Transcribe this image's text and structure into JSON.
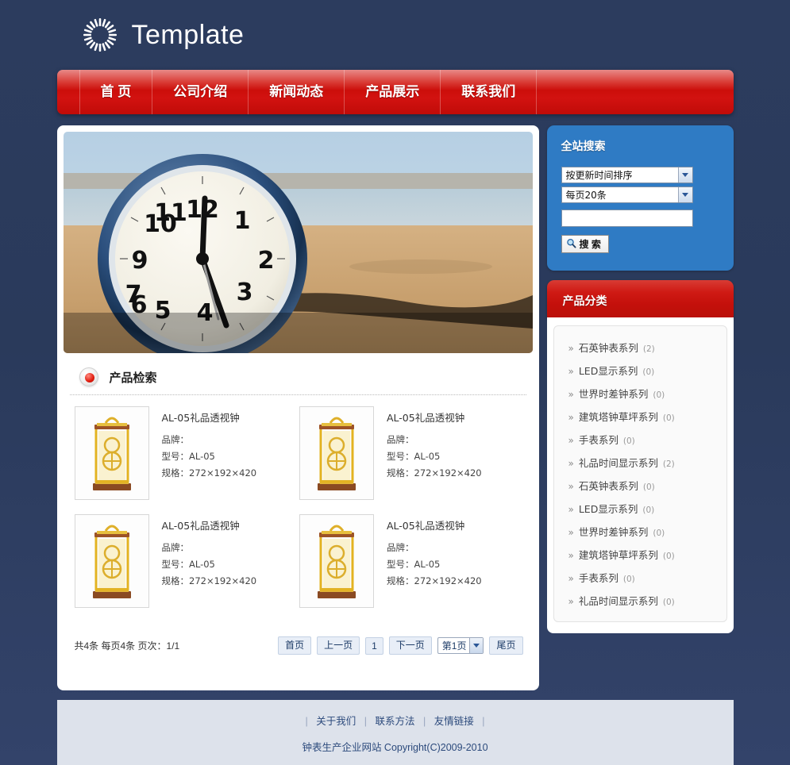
{
  "site": {
    "logo_icon": "sunburst-icon",
    "title": "Template"
  },
  "nav": {
    "items": [
      {
        "label": "首 页"
      },
      {
        "label": "公司介绍"
      },
      {
        "label": "新闻动态"
      },
      {
        "label": "产品展示"
      },
      {
        "label": "联系我们"
      }
    ]
  },
  "banner": {
    "alt": "beach-clock-banner"
  },
  "section": {
    "title": "产品检索",
    "bullet_icon": "red-dot-icon"
  },
  "products": [
    {
      "name": "AL-05礼品透视钟",
      "brand_label": "品牌：",
      "brand_value": "",
      "model": "型号：AL-05",
      "spec": "规格：272×192×420"
    },
    {
      "name": "AL-05礼品透视钟",
      "brand_label": "品牌：",
      "brand_value": "",
      "model": "型号：AL-05",
      "spec": "规格：272×192×420"
    },
    {
      "name": "AL-05礼品透视钟",
      "brand_label": "品牌：",
      "brand_value": "",
      "model": "型号：AL-05",
      "spec": "规格：272×192×420"
    },
    {
      "name": "AL-05礼品透视钟",
      "brand_label": "品牌：",
      "brand_value": "",
      "model": "型号：AL-05",
      "spec": "规格：272×192×420"
    }
  ],
  "pagination": {
    "info": "共4条 每页4条 页次：1/1",
    "first": "首页",
    "prev": "上一页",
    "current_num": "1",
    "next": "下一页",
    "page_select": "第1页",
    "last": "尾页"
  },
  "search": {
    "title": "全站搜索",
    "sort_select": "按更新时间排序",
    "pagesize_select": "每页20条",
    "keyword_value": "",
    "keyword_placeholder": "",
    "button_label": "搜 索",
    "button_icon": "magnifier-icon"
  },
  "categories": {
    "title": "产品分类",
    "items": [
      {
        "label": "石英钟表系列",
        "count": "(2)"
      },
      {
        "label": "LED显示系列",
        "count": "(0)"
      },
      {
        "label": "世界时差钟系列",
        "count": "(0)"
      },
      {
        "label": "建筑塔钟草坪系列",
        "count": "(0)"
      },
      {
        "label": "手表系列",
        "count": "(0)"
      },
      {
        "label": "礼品时间显示系列",
        "count": "(2)"
      },
      {
        "label": "石英钟表系列",
        "count": "(0)"
      },
      {
        "label": "LED显示系列",
        "count": "(0)"
      },
      {
        "label": "世界时差钟系列",
        "count": "(0)"
      },
      {
        "label": "建筑塔钟草坪系列",
        "count": "(0)"
      },
      {
        "label": "手表系列",
        "count": "(0)"
      },
      {
        "label": "礼品时间显示系列",
        "count": "(0)"
      }
    ]
  },
  "footer": {
    "links": [
      {
        "label": "关于我们"
      },
      {
        "label": "联系方法"
      },
      {
        "label": "友情链接"
      }
    ],
    "copyright": "钟表生产企业网站  Copyright(C)2009-2010"
  },
  "colors": {
    "page_background": "#2a3a5b",
    "nav_red": "#cc0e0a",
    "search_blue": "#2f7bc4",
    "category_red": "#c4100b",
    "footer_bg": "#dde2eb",
    "footer_text": "#2c4a7c"
  }
}
